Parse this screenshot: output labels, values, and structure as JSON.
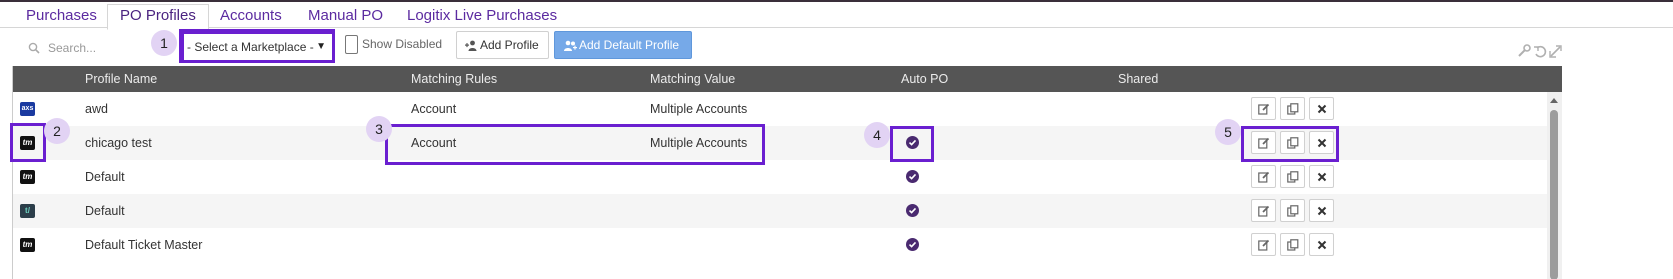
{
  "tabs": [
    {
      "label": "Purchases",
      "active": false
    },
    {
      "label": "PO Profiles",
      "active": true
    },
    {
      "label": "Accounts",
      "active": false
    },
    {
      "label": "Manual PO",
      "active": false
    },
    {
      "label": "Logitix Live Purchases",
      "active": false
    }
  ],
  "toolbar": {
    "search_placeholder": "Search...",
    "marketplace_select": "- Select a Marketplace -",
    "show_disabled_label": "Show Disabled",
    "add_profile_label": "Add Profile",
    "add_default_profile_label": "Add Default Profile"
  },
  "table": {
    "headers": {
      "profile_name": "Profile Name",
      "matching_rules": "Matching Rules",
      "matching_value": "Matching Value",
      "auto_po": "Auto PO",
      "shared": "Shared"
    },
    "rows": [
      {
        "marketplace_icon": "axs",
        "marketplace_label": "axs",
        "profile_name": "awd",
        "matching_rules": "Account",
        "matching_value": "Multiple Accounts",
        "auto_po": false
      },
      {
        "marketplace_icon": "ticketmaster",
        "marketplace_label": "tm",
        "profile_name": "chicago test",
        "matching_rules": "Account",
        "matching_value": "Multiple Accounts",
        "auto_po": true
      },
      {
        "marketplace_icon": "ticketmaster",
        "marketplace_label": "tm",
        "profile_name": "Default",
        "matching_rules": "",
        "matching_value": "",
        "auto_po": true
      },
      {
        "marketplace_icon": "tv",
        "marketplace_label": "t/",
        "profile_name": "Default",
        "matching_rules": "",
        "matching_value": "",
        "auto_po": true
      },
      {
        "marketplace_icon": "ticketmaster",
        "marketplace_label": "tm",
        "profile_name": "Default Ticket Master",
        "matching_rules": "",
        "matching_value": "",
        "auto_po": true
      }
    ]
  },
  "annotations": [
    "1",
    "2",
    "3",
    "4",
    "5"
  ],
  "colors": {
    "accent": "#5b2aa0",
    "highlight": "#6a1fd0",
    "badge_bg": "#e2d3f4",
    "header_bg": "#555555",
    "primary_button": "#76a9e8",
    "check": "#4a2a70"
  }
}
